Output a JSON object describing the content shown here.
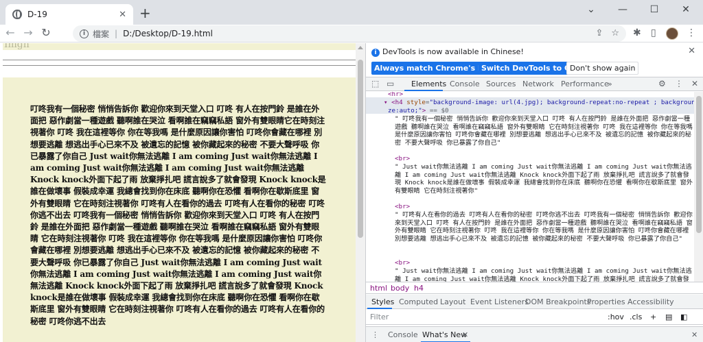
{
  "browser": {
    "tab_title": "D-19",
    "tab_close": "✕",
    "new_tab": "+",
    "controls": [
      "⌄",
      "—",
      "☐",
      "✕"
    ],
    "nav": {
      "back": "←",
      "forward": "→",
      "reload": "↻"
    },
    "address": {
      "info_glyph": "i",
      "scheme_label": "檔案",
      "separator": "|",
      "url": "D:/Desktop/D-19.html"
    },
    "toolbar_icons": [
      "share-icon",
      "star-icon",
      "extensions-icon",
      "sidebar-icon",
      "avatar",
      "menu-icon"
    ],
    "toolbar_glyphs": {
      "share": "⇪",
      "star": "☆",
      "extensions": "✱",
      "sidebar": "▯",
      "menu": "⋮"
    }
  },
  "page": {
    "cutoff_text": "Imgh",
    "h4_text": "叮咚我有一個秘密 悄悄告訴你 歡迎你來到天堂入口 叮咚 有人在按門鈴 是誰在外面把 惡作劇當一種遊戲 聽啊誰在哭泣 看啊誰在竊竊私語 窗外有雙眼睛它在時刻注視著你 叮咚 我在這裡等你 你在等我嗎 是什麼原因讓你害怕 叮咚你會藏在哪裡 別想要逃離 想逃出手心已來不及 被遺忘的記憶 被你藏起來的秘密 不要大聲呼吸 你已暴露了你自己 Just wait你無法逃離 I am coming Just wait你無法逃離 I am coming Just wait你無法逃離 I am coming Just wait你無法逃離 Knock knock外面下起了雨 放棄掙扎吧 謊言說多了就會發現 Knock knock是誰在做壞事 假裝成幸運 我總會找到你在床底 聽啊你在恐懼 看啊你在歇斯底里 窗外有雙眼睛 它在時刻注視著你 叮咚有人在看你的過去 叮咚有人在看你的秘密 叮咚你逃不出去 叮咚我有一個秘密 悄悄告訴你 歡迎你來到天堂入口 叮咚 有人在按門鈴 是誰在外面把 惡作劇當一種遊戲 聽啊誰在哭泣 看啊誰在竊竊私語 窗外有雙眼睛 它在時刻注視著你 叮咚 我在這裡等你 你在等我嗎 是什麼原因讓你害怕 叮咚你會藏在哪裡 別想要逃離 想逃出手心已來不及 被遺忘的記憶 被你藏起來的秘密 不要大聲呼吸 你已暴露了你自己 Just wait你無法逃離 I am coming Just wait你無法逃離 I am coming Just wait你無法逃離 I am coming Just wait你無法逃離 Knock knock外面下起了雨 放棄掙扎吧 謊言說多了就會發現 Knock knock是誰在做壞事 假裝成幸運 我總會找到你在床底 聽啊你在恐懼 看啊你在歇斯底里 窗外有雙眼睛 它在時刻注視著你 叮咚有人在看你的過去 叮咚有人在看你的秘密 叮咚你逃不出去"
  },
  "devtools": {
    "banner": {
      "info_glyph": "i",
      "message": "DevTools is now available in Chinese!",
      "btn_match": "Always match Chrome's language",
      "btn_switch": "Switch DevTools to Chinese",
      "btn_dismiss": "Don't show again",
      "close": "✕"
    },
    "tabs": [
      "Elements",
      "Console",
      "Sources",
      "Network",
      "Performance",
      "»"
    ],
    "tab_icons": {
      "inspect": "⬚",
      "device": "▭",
      "settings": "⚙",
      "more": "⋮",
      "close": "✕"
    },
    "code": {
      "hr_line": "<hr>",
      "h4_open_tag": "<h4",
      "h4_style_attr": "style",
      "h4_style_value_1": "\"background-image: url(4.jpg); background-repeat:no-repeat ; background-si",
      "h4_style_value_2": "ze:auto;\"",
      "h4_close": ">",
      "dollar": "== $0",
      "text_1": "\" 叮咚我有一個秘密 悄悄告訴你 歡迎你來到天堂入口 叮咚 有人在按門鈴 是誰在外面把 惡作劇當一種遊戲 聽啊誰在哭泣 看啊誰在竊竊私語 窗外有雙眼睛 它在時刻注視著你 叮咚 我在這裡等你 你在等我嗎 是什麼原因讓你害怕 叮咚你會藏在哪裡 別想要逃離 想逃出手心已來不及 被遺忘的記憶 被你藏起來的秘密 不要大聲呼吸 你已暴露了你自己\"",
      "br": "<br>",
      "text_2": "\" Just wait你無法逃離 I am coming Just wait你無法逃離 I am coming Just wait你無法逃離 I am coming Just wait你無法逃離 Knock knock外面下起了雨 放棄掙扎吧 謊言說多了就會發現 Knock knock是誰在做壞事 假裝成幸運 我總會找到你在床底 聽啊你在恐懼 看啊你在歇斯底里 窗外有雙眼睛 它在時刻注視著你\"",
      "text_3": "\" 叮咚有人在看你的過去 叮咚有人在看你的秘密 叮咚你逃不出去 叮咚我有一個秘密 悄悄告訴你 歡迎你來到天堂入口 叮咚 有人在按門鈴 是誰在外面把 惡作劇當一種遊戲 聽啊誰在哭泣 看啊誰在竊竊私語 窗外有雙眼睛 它在時刻注視著你 叮咚 我在這裡等你 你在等我嗎 是什麼原因讓你害怕 叮咚你會藏在哪裡 別想要逃離 想逃出手心已來不及 被遺忘的記憶 被你藏起來的秘密 不要大聲呼吸 你已暴露了你自己\"",
      "text_4": "\" Just wait你無法逃離 I am coming Just wait你無法逃離 I am coming Just wait你無法逃離 I am coming Just wait你無法逃離 Knock knock外面下起了雨 放棄掙扎吧 謊言說多了就會發現"
    },
    "breadcrumbs": [
      "html",
      "body",
      "h4"
    ],
    "styles_tabs": [
      "Styles",
      "Computed",
      "Layout",
      "Event Listeners",
      "DOM Breakpoints",
      "Properties",
      "Accessibility"
    ],
    "filter": {
      "placeholder": "Filter",
      "hov": ":hov",
      "cls": ".cls",
      "plus": "+"
    },
    "drawer_tabs": [
      "Console",
      "What's New"
    ],
    "drawer_close": "✕",
    "drawer_menu": "⋮"
  },
  "colors": {
    "page_background": "#f2f1d2",
    "accent": "#1a73e8",
    "tag": "#881280"
  }
}
